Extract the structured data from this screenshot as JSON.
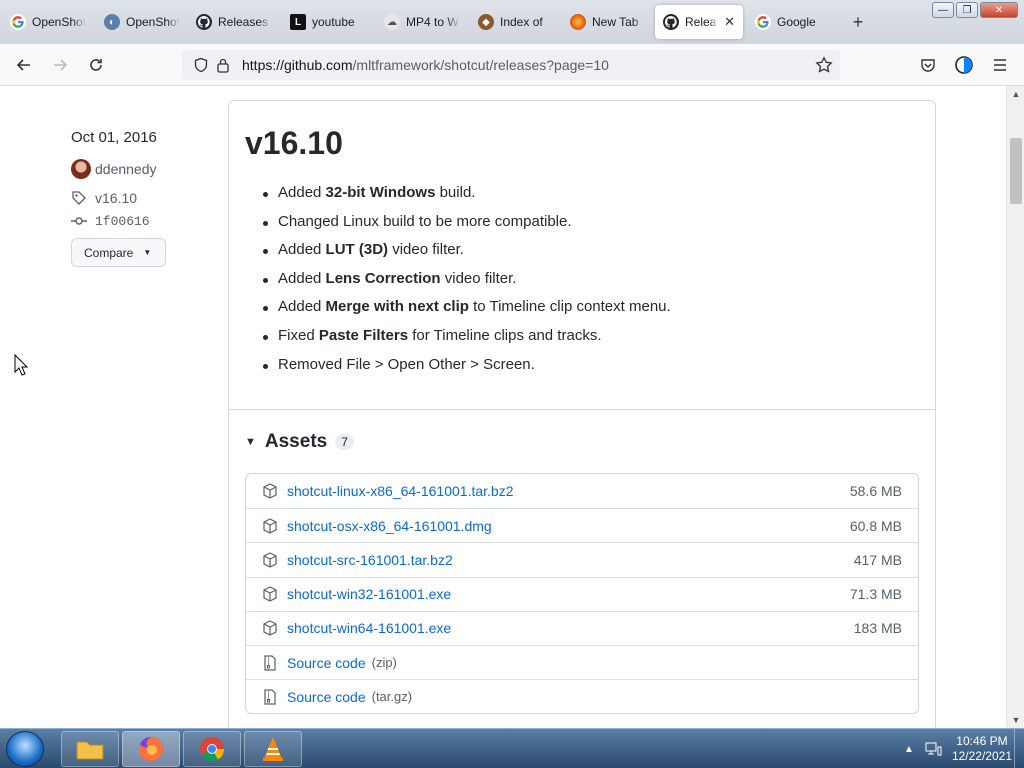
{
  "browser": {
    "tabs": [
      {
        "label": "OpenShot",
        "icon": "google-icon",
        "active": false
      },
      {
        "label": "OpenShot",
        "icon": "openshot-icon",
        "active": false
      },
      {
        "label": "Releases",
        "icon": "github-icon",
        "active": false
      },
      {
        "label": "youtube",
        "icon": "bookmark-icon",
        "active": false
      },
      {
        "label": "MP4 to W",
        "icon": "cloud-icon",
        "active": false
      },
      {
        "label": "Index of",
        "icon": "folder-icon",
        "active": false
      },
      {
        "label": "New Tab",
        "icon": "firefox-icon",
        "active": false
      },
      {
        "label": "Releases",
        "icon": "github-icon",
        "active": true
      },
      {
        "label": "Google",
        "icon": "google-icon",
        "active": false
      }
    ],
    "url_host": "https://github.com",
    "url_path": "/mltframework/shotcut/releases?page=10"
  },
  "release": {
    "date": "Oct 01, 2016",
    "author": "ddennedy",
    "tag": "v16.10",
    "commit": "1f00616",
    "compare_label": "Compare",
    "title": "v16.10",
    "notes": [
      {
        "pre": "Added ",
        "bold": "32-bit Windows",
        "post": " build."
      },
      {
        "pre": "Changed Linux build to be more compatible.",
        "bold": "",
        "post": ""
      },
      {
        "pre": "Added ",
        "bold": "LUT (3D)",
        "post": " video filter."
      },
      {
        "pre": "Added ",
        "bold": "Lens Correction",
        "post": " video filter."
      },
      {
        "pre": "Added ",
        "bold": "Merge with next clip",
        "post": " to Timeline clip context menu."
      },
      {
        "pre": "Fixed ",
        "bold": "Paste Filters",
        "post": " for Timeline clips and tracks."
      },
      {
        "pre": "Removed File > Open Other > Screen.",
        "bold": "",
        "post": ""
      }
    ],
    "assets_label": "Assets",
    "assets_count": "7",
    "assets": [
      {
        "name": "shotcut-linux-x86_64-161001.tar.bz2",
        "sub": "",
        "size": "58.6 MB",
        "icon": "package-icon"
      },
      {
        "name": "shotcut-osx-x86_64-161001.dmg",
        "sub": "",
        "size": "60.8 MB",
        "icon": "package-icon"
      },
      {
        "name": "shotcut-src-161001.tar.bz2",
        "sub": "",
        "size": "417 MB",
        "icon": "package-icon"
      },
      {
        "name": "shotcut-win32-161001.exe",
        "sub": "",
        "size": "71.3 MB",
        "icon": "package-icon"
      },
      {
        "name": "shotcut-win64-161001.exe",
        "sub": "",
        "size": "183 MB",
        "icon": "package-icon"
      },
      {
        "name": "Source code",
        "sub": "(zip)",
        "size": "",
        "icon": "file-zip-icon"
      },
      {
        "name": "Source code",
        "sub": "(tar.gz)",
        "size": "",
        "icon": "file-zip-icon"
      }
    ]
  },
  "taskbar": {
    "time": "10:46 PM",
    "date": "12/22/2021"
  },
  "colors": {
    "link": "#0969da",
    "firefox_accent": "#0a84ff"
  }
}
